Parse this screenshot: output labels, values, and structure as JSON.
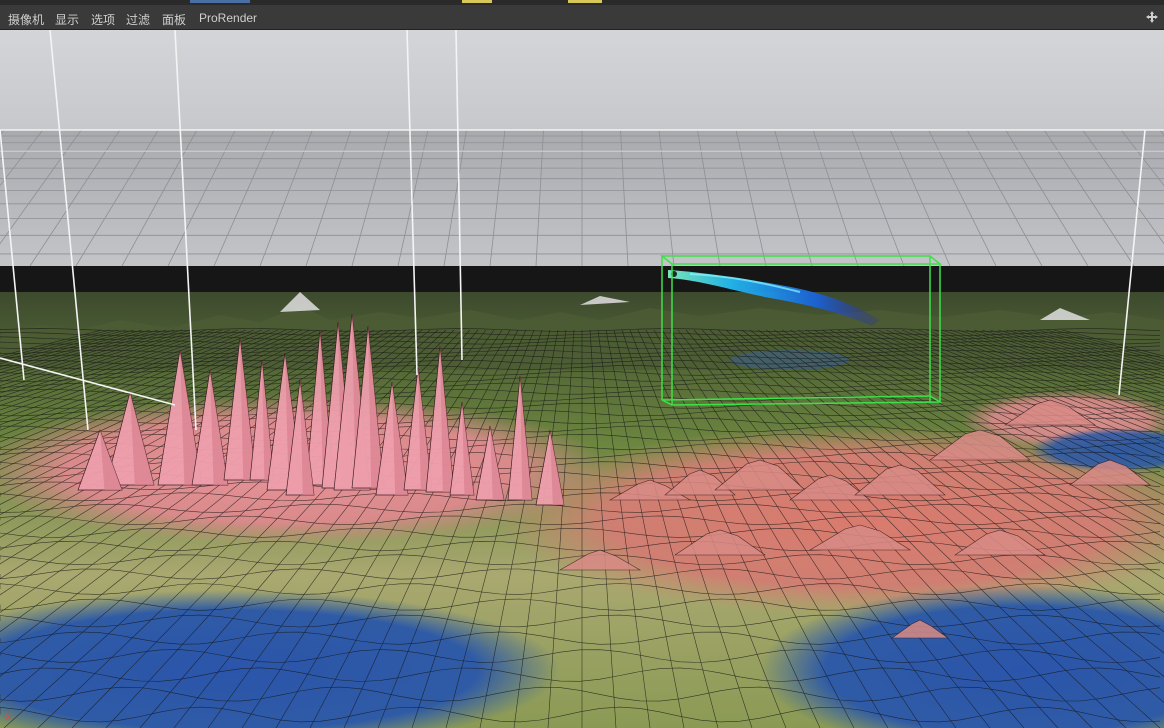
{
  "menubar": {
    "items": [
      {
        "id": "camera",
        "label": "摄像机"
      },
      {
        "id": "display",
        "label": "显示"
      },
      {
        "id": "options",
        "label": "选项"
      },
      {
        "id": "filter",
        "label": "过滤"
      },
      {
        "id": "panel",
        "label": "面板"
      },
      {
        "id": "prorender",
        "label": "ProRender"
      }
    ],
    "nav_icon": "move-viewport-icon"
  },
  "viewport": {
    "axis_label": "X",
    "colors": {
      "sky": "#cfd0d4",
      "floor_grid": "#bcbdc2",
      "terrain_peaks": "#e99aa6",
      "terrain_low": "#5e7a3a",
      "water": "#2d55a6",
      "bounding_box": "#3ee04a",
      "smoke": "#2a9ee8"
    },
    "objects": [
      "floor-grid",
      "terrain-heightmap",
      "water-plane",
      "smoke-simulation",
      "simulation-bounding-box",
      "guide-lines"
    ]
  }
}
